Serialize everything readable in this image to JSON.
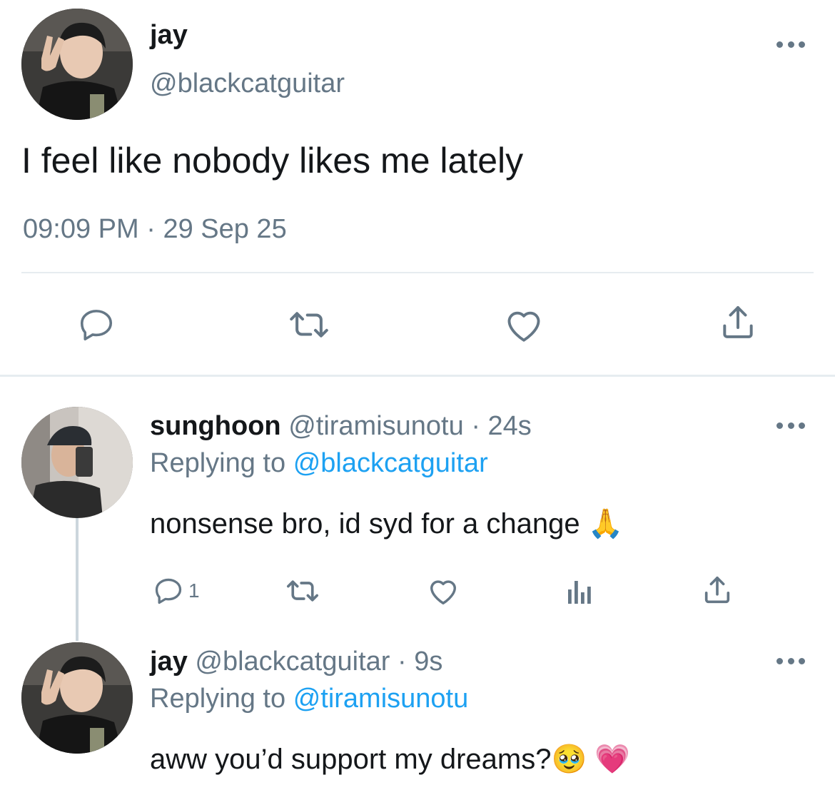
{
  "tweet": {
    "author_name": "jay",
    "author_handle": "@blackcatguitar",
    "text": "I feel like nobody likes me lately",
    "time": "09:09 PM",
    "date": "29 Sep 25",
    "dot": "·"
  },
  "actions": [
    "reply-icon",
    "retweet-icon",
    "like-icon",
    "share-icon"
  ],
  "replies": [
    {
      "name": "sunghoon",
      "handle": "@tiramisunotu",
      "age": "24s",
      "replying_prefix": "Replying to",
      "replying_to": "@blackcatguitar",
      "text": "nonsense bro, id syd for a change 🙏",
      "reply_count": "1",
      "icons": [
        "reply-icon",
        "retweet-icon",
        "like-icon",
        "analytics-icon",
        "share-icon"
      ]
    },
    {
      "name": "jay",
      "handle": "@blackcatguitar",
      "age": "9s",
      "replying_prefix": "Replying to",
      "replying_to": "@tiramisunotu",
      "text": "aww you’d support my dreams?🥹 💗"
    }
  ],
  "colors": {
    "text": "#14171a",
    "secondary": "#657786",
    "mention": "#1da1f2",
    "divider": "#e6ecf0"
  }
}
